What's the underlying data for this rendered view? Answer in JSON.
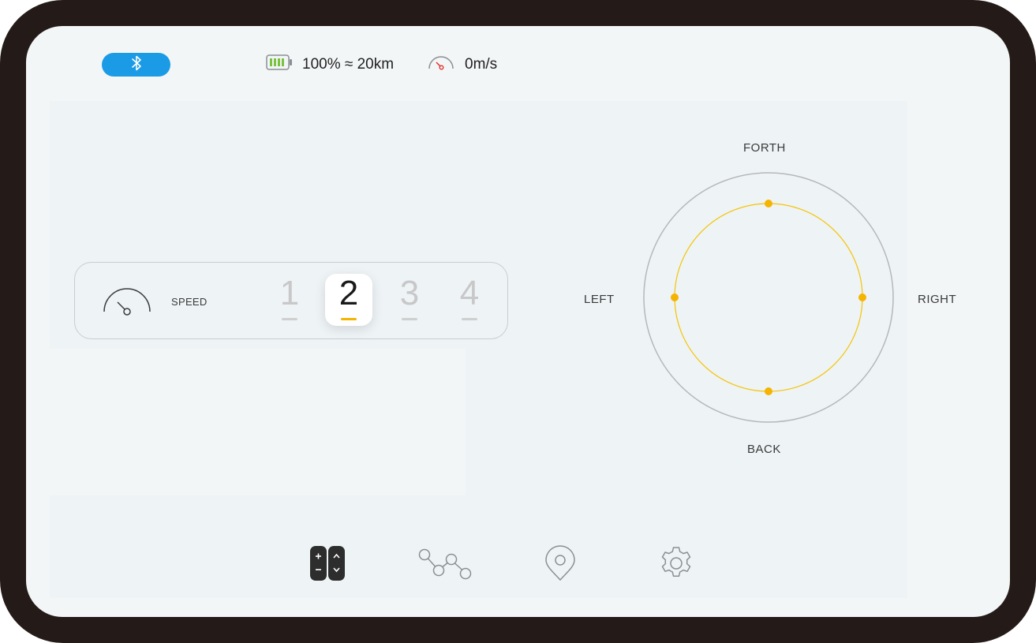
{
  "status": {
    "bluetooth_icon": "bluetooth-icon",
    "bluetooth_color": "#1b9be6",
    "battery_icon": "battery-icon",
    "battery_color": "#7cc242",
    "battery_text": "100% ≈ 20km",
    "speed_icon": "speedometer-icon",
    "speed_text": "0m/s"
  },
  "speed_panel": {
    "label": "SPEED",
    "icon": "speedometer-icon",
    "gears": [
      {
        "label": "1",
        "active": false
      },
      {
        "label": "2",
        "active": true
      },
      {
        "label": "3",
        "active": false
      },
      {
        "label": "4",
        "active": false
      }
    ],
    "accent_color": "#f5b400"
  },
  "direction": {
    "forth": "FORTH",
    "back": "BACK",
    "left": "LEFT",
    "right": "RIGHT",
    "ring_color": "#f5c400"
  },
  "nav": [
    {
      "icon": "control-pad-icon",
      "active": true
    },
    {
      "icon": "route-nodes-icon",
      "active": false
    },
    {
      "icon": "location-pin-icon",
      "active": false
    },
    {
      "icon": "settings-gear-icon",
      "active": false
    }
  ]
}
